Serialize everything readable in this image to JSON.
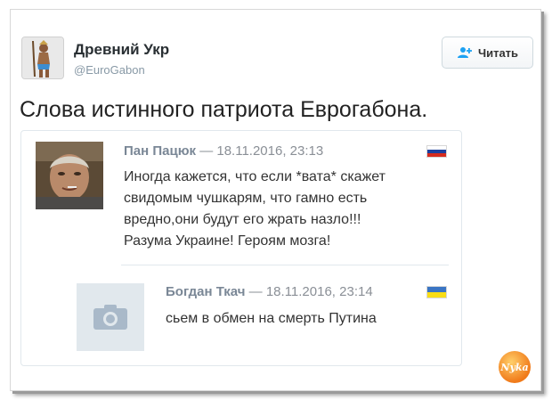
{
  "tweet": {
    "author_name": "Древний Укр",
    "author_handle": "@EuroGabon",
    "follow_label": "Читать",
    "text": "Слова истинного патриота Еврогабона."
  },
  "quote": {
    "comments": [
      {
        "author": "Пан Пацюк",
        "separator": "—",
        "date": "18.11.2016, 23:13",
        "flag": "russia",
        "lines": [
          "Иногда кажется, что если *вата* скажет",
          "свидомым чушкарям, что гамно есть",
          "вредно,они будут его жрать назло!!!",
          "Разума Украине! Героям мозга!"
        ]
      },
      {
        "author": "Богдан Ткач",
        "separator": "—",
        "date": "18.11.2016, 23:14",
        "flag": "ukraine",
        "text": "сьем в обмен на смерть Путина"
      }
    ]
  },
  "colors": {
    "flag_russia": [
      "#ffffff",
      "#1c3f9e",
      "#d52b1e"
    ],
    "flag_ukraine": [
      "#3a75c4",
      "#f9dd16"
    ],
    "follow_icon": "#1da1f2"
  },
  "icons": {
    "follow": "add-user-icon",
    "placeholder": "camera-icon"
  }
}
